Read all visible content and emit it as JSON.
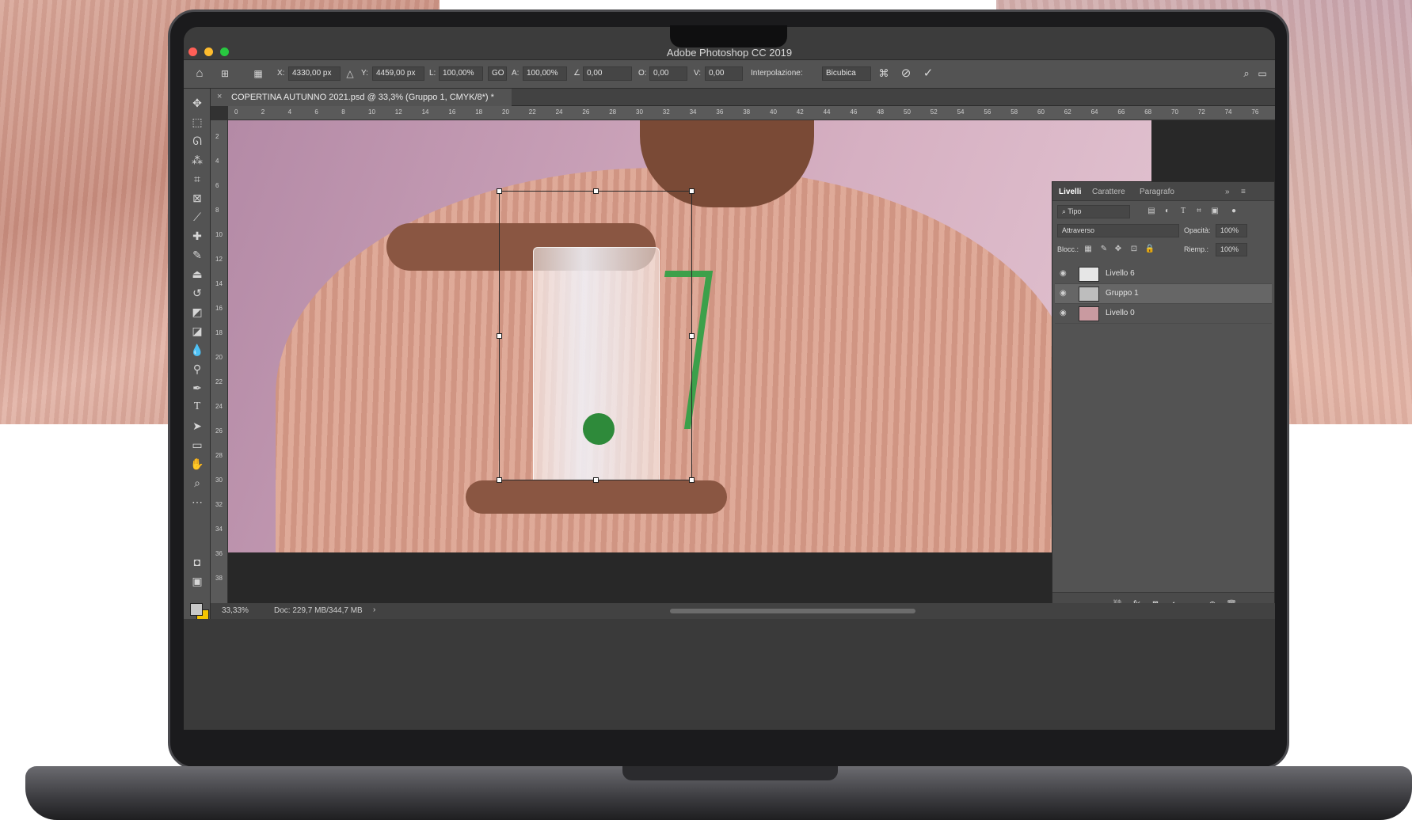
{
  "window": {
    "title": "Adobe Photoshop CC 2019"
  },
  "options_bar": {
    "x_label": "X:",
    "x_value": "4330,00 px",
    "y_label": "Y:",
    "y_value": "4459,00 px",
    "w_label": "L:",
    "w_value": "100,00%",
    "link_label": "GO",
    "h_label": "A:",
    "h_value": "100,00%",
    "angle_label": "∠",
    "angle_value": "0,00",
    "hskew_label": "O:",
    "hskew_value": "0,00",
    "vskew_label": "V:",
    "vskew_value": "0,00",
    "interp_label": "Interpolazione:",
    "interp_value": "Bicubica"
  },
  "document": {
    "tab_label": "COPERTINA AUTUNNO 2021.psd @ 33,3% (Gruppo 1, CMYK/8*) *",
    "ruler_top": [
      "0",
      "2",
      "4",
      "6",
      "8",
      "10",
      "12",
      "14",
      "16",
      "18",
      "20",
      "22",
      "24",
      "26",
      "28",
      "30",
      "32",
      "34",
      "36",
      "38",
      "40",
      "42",
      "44",
      "46",
      "48",
      "50",
      "52",
      "54",
      "56",
      "58",
      "60",
      "62",
      "64",
      "66",
      "68",
      "70",
      "72",
      "74",
      "76"
    ],
    "ruler_left": [
      "2",
      "4",
      "6",
      "8",
      "10",
      "12",
      "14",
      "16",
      "18",
      "20",
      "22",
      "24",
      "26",
      "28",
      "30",
      "32",
      "34",
      "36",
      "38"
    ]
  },
  "status": {
    "zoom": "33,33%",
    "doc": "Doc: 229,7 MB/344,7 MB",
    "arrow": "›"
  },
  "layers_panel": {
    "tabs": [
      "Livelli",
      "Carattere",
      "Paragrafo"
    ],
    "filter_value": "Tipo",
    "blend_mode": "Attraverso",
    "opacity_label": "Opacità:",
    "opacity_value": "100%",
    "lock_label": "Blocc.:",
    "fill_label": "Riemp.:",
    "fill_value": "100%",
    "layers": [
      {
        "name": "Livello 6",
        "thumb_color": "#e6e6e6",
        "selected": false
      },
      {
        "name": "Gruppo 1",
        "thumb_color": "#bdbdbd",
        "selected": true
      },
      {
        "name": "Livello 0",
        "thumb_color": "#c99aa0",
        "selected": false
      }
    ]
  },
  "icons": {
    "home": "home-icon",
    "move": "move-icon",
    "marquee": "marquee-icon",
    "lasso": "lasso-icon",
    "brush": "brush-icon",
    "type": "type-icon",
    "eye": "eye-icon",
    "cancel": "cancel-icon",
    "commit": "checkmark-icon"
  },
  "colors": {
    "fg": "#c8c8c8",
    "bg": "#f5c400",
    "traffic_red": "#ff5f57",
    "traffic_yellow": "#febc2e",
    "traffic_green": "#28c840"
  }
}
